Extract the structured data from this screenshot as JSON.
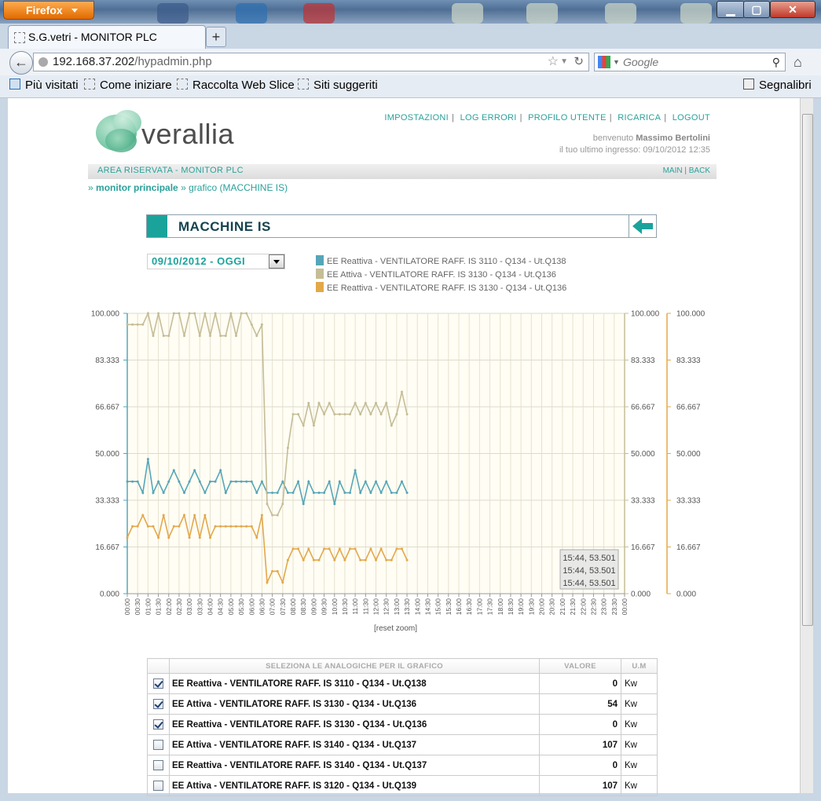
{
  "browser": {
    "app_button": "Firefox",
    "tab_title": "S.G.vetri - MONITOR PLC",
    "url_host": "192.168.37.202",
    "url_path": "/hypadmin.php",
    "search_placeholder": "Google",
    "bookmarks": [
      "Più visitati",
      "Come iniziare",
      "Raccolta Web Slice",
      "Siti suggeriti"
    ],
    "bookmarks_right": "Segnalibri"
  },
  "header": {
    "logo_text": "verallia",
    "links": [
      "IMPOSTAZIONI",
      "LOG ERRORI",
      "PROFILO UTENTE",
      "RICARICA",
      "LOGOUT"
    ],
    "welcome_prefix": "benvenuto",
    "user": "Massimo Bertolini",
    "last_login": "il tuo ultimo ingresso: 09/10/2012 12:35",
    "area": "AREA RISERVATA - MONITOR PLC",
    "area_links": [
      "MAIN",
      "BACK"
    ],
    "crumb_sep": "»",
    "crumb_main": "monitor principale",
    "crumb_page": "grafico (MACCHINE IS)"
  },
  "section_title": "MACCHINE IS",
  "date_select": "09/10/2012 - OGGI",
  "reset_zoom": "[reset zoom]",
  "chart_data": {
    "type": "line",
    "y_ticks": [
      "100.000",
      "83.333",
      "66.667",
      "50.000",
      "33.333",
      "16.667",
      "0.000"
    ],
    "ylim": [
      0,
      100
    ],
    "x_tick_labels": [
      "00:00",
      "00:30",
      "01:00",
      "01:30",
      "02:00",
      "02:30",
      "03:00",
      "03:30",
      "04:00",
      "04:30",
      "05:00",
      "05:30",
      "06:00",
      "06:30",
      "07:00",
      "07:30",
      "08:00",
      "08:30",
      "09:00",
      "09:30",
      "10:00",
      "10:30",
      "11:00",
      "11:30",
      "12:00",
      "12:30",
      "13:00",
      "13:30",
      "14:00",
      "14:30",
      "15:00",
      "15:30",
      "16:00",
      "16:30",
      "17:00",
      "17:30",
      "18:00",
      "18:30",
      "19:00",
      "19:30",
      "20:00",
      "20:30",
      "21:00",
      "21:30",
      "22:00",
      "22:30",
      "23:00",
      "23:30",
      "00:00"
    ],
    "series": [
      {
        "name": "EE Reattiva - VENTILATORE RAFF. IS 3110 - Q134 - Ut.Q138",
        "color": "#55a6b8",
        "values": [
          40,
          40,
          40,
          36,
          48,
          36,
          40,
          36,
          40,
          44,
          40,
          36,
          40,
          44,
          40,
          36,
          40,
          40,
          44,
          36,
          40,
          40,
          40,
          40,
          40,
          36,
          40,
          36,
          36,
          36,
          40,
          36,
          36,
          40,
          32,
          40,
          36,
          36,
          36,
          40,
          32,
          40,
          36,
          36,
          44,
          36,
          40,
          36,
          40,
          36,
          40,
          36,
          36,
          40,
          36
        ]
      },
      {
        "name": "EE Attiva - VENTILATORE RAFF. IS 3130 - Q134 - Ut.Q136",
        "color": "#c5bd96",
        "values": [
          96,
          96,
          96,
          96,
          100,
          92,
          100,
          92,
          92,
          100,
          100,
          92,
          100,
          100,
          92,
          100,
          92,
          100,
          92,
          92,
          100,
          92,
          100,
          100,
          96,
          92,
          96,
          32,
          28,
          28,
          32,
          52,
          64,
          64,
          60,
          68,
          60,
          68,
          64,
          68,
          64,
          64,
          64,
          64,
          68,
          64,
          68,
          64,
          68,
          64,
          68,
          60,
          64,
          72,
          64
        ]
      },
      {
        "name": "EE Reattiva - VENTILATORE RAFF. IS 3130 - Q134 - Ut.Q136",
        "color": "#e3a84a",
        "values": [
          20,
          24,
          24,
          28,
          24,
          24,
          20,
          28,
          20,
          24,
          24,
          28,
          20,
          28,
          20,
          28,
          20,
          24,
          24,
          24,
          24,
          24,
          24,
          24,
          24,
          20,
          28,
          4,
          8,
          8,
          4,
          12,
          16,
          16,
          12,
          16,
          12,
          12,
          16,
          16,
          12,
          16,
          12,
          16,
          16,
          12,
          12,
          16,
          12,
          16,
          12,
          12,
          16,
          16,
          12
        ]
      }
    ],
    "tooltip_lines": [
      "15:44, 53.501",
      "15:44, 53.501",
      "15:44, 53.501"
    ]
  },
  "table": {
    "headers": [
      "SELEZIONA LE ANALOGICHE PER IL GRAFICO",
      "VALORE",
      "U.M"
    ],
    "rows": [
      {
        "checked": true,
        "name": "EE Reattiva - VENTILATORE RAFF. IS 3110 - Q134 - Ut.Q138",
        "value": "0",
        "um": "Kw"
      },
      {
        "checked": true,
        "name": "EE Attiva - VENTILATORE RAFF. IS 3130 - Q134 - Ut.Q136",
        "value": "54",
        "um": "Kw"
      },
      {
        "checked": true,
        "name": "EE Reattiva - VENTILATORE RAFF. IS 3130 - Q134 - Ut.Q136",
        "value": "0",
        "um": "Kw"
      },
      {
        "checked": false,
        "name": "EE Attiva - VENTILATORE RAFF. IS 3140 - Q134 - Ut.Q137",
        "value": "107",
        "um": "Kw"
      },
      {
        "checked": false,
        "name": "EE Reattiva - VENTILATORE RAFF. IS 3140 - Q134 - Ut.Q137",
        "value": "0",
        "um": "Kw"
      },
      {
        "checked": false,
        "name": "EE Attiva - VENTILATORE RAFF. IS 3120 - Q134 - Ut.Q139",
        "value": "107",
        "um": "Kw"
      }
    ]
  }
}
